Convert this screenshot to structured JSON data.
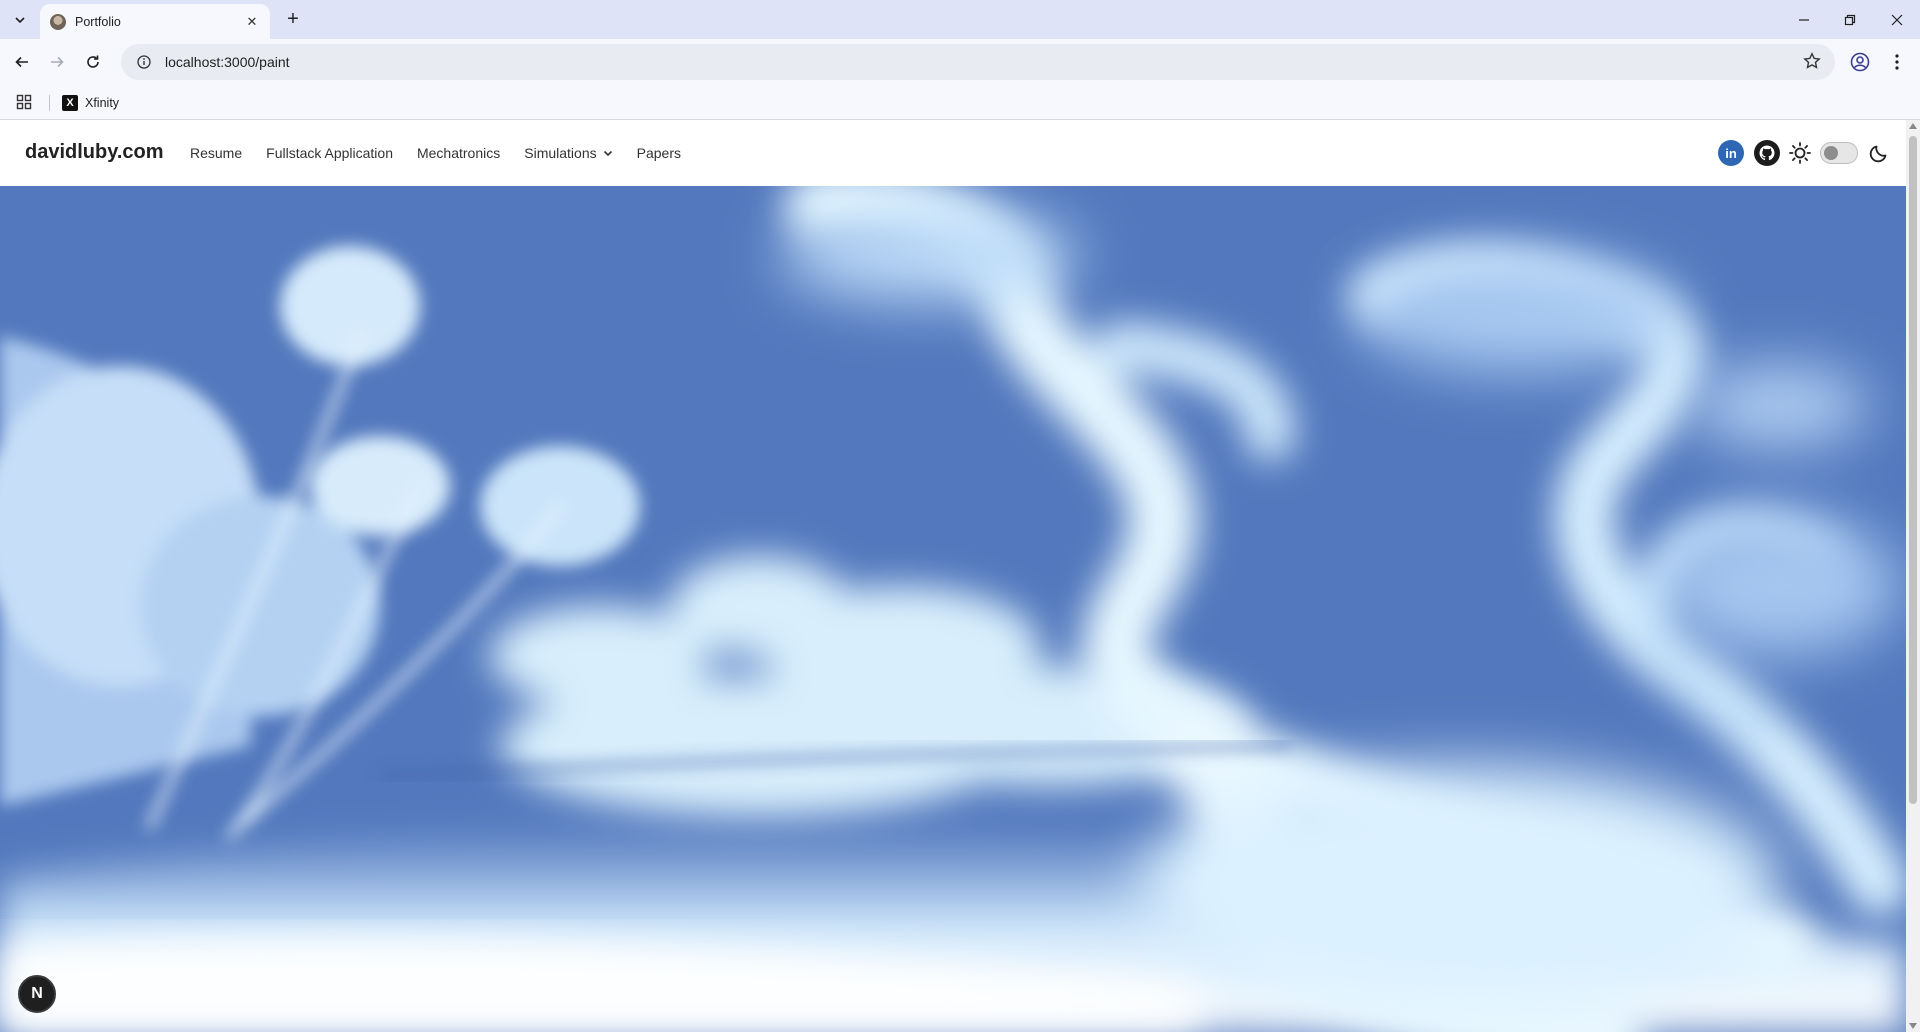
{
  "browser": {
    "tab_title": "Portfolio",
    "url": "localhost:3000/paint",
    "bookmarks": [
      {
        "label": "Xfinity",
        "icon": "x-logo-icon"
      }
    ]
  },
  "site": {
    "brand": "davidluby.com",
    "nav": [
      {
        "label": "Resume"
      },
      {
        "label": "Fullstack Application"
      },
      {
        "label": "Mechatronics"
      },
      {
        "label": "Simulations",
        "dropdown": true
      },
      {
        "label": "Papers"
      }
    ],
    "icons": [
      "linkedin-icon",
      "github-icon",
      "sun-icon",
      "theme-toggle",
      "moon-icon"
    ],
    "theme_toggle_on": false,
    "linkedin_text": "in"
  },
  "canvas": {
    "description_colors": {
      "background": "#5378bd",
      "fluid": "#e6f7ff"
    }
  },
  "dev_badge": "N"
}
